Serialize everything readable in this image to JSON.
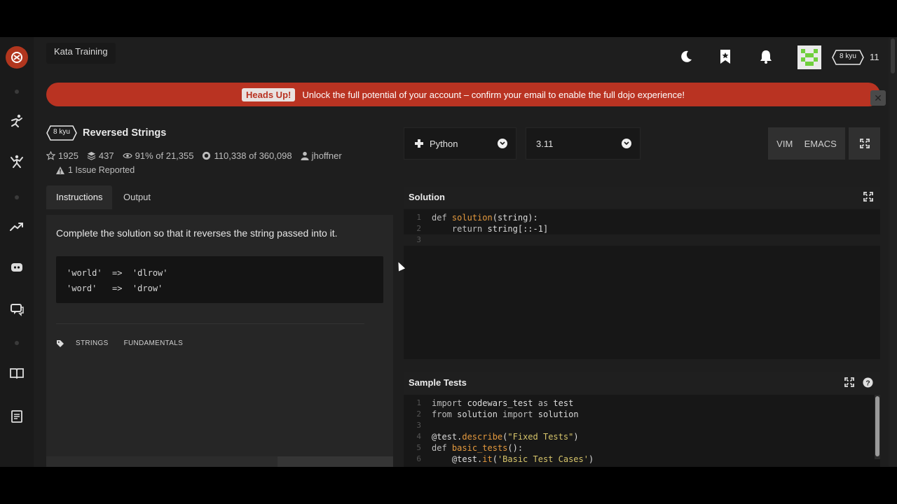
{
  "header": {
    "tab_label": "Kata Training",
    "rank_badge": "8 kyu",
    "honor": "11",
    "icons": [
      "moon-icon",
      "bookmark-icon",
      "bell-icon",
      "avatar"
    ]
  },
  "sidebar": {
    "icons": [
      "logo",
      "dojo-icon",
      "kata-icon",
      "trending-icon",
      "discord-icon",
      "chat-icon",
      "book-icon",
      "docs-icon"
    ]
  },
  "banner": {
    "pill": "Heads Up!",
    "message": "Unlock the full potential of your account – confirm your email to enable the full dojo experience!"
  },
  "kata": {
    "kyu": "8 kyu",
    "title": "Reversed Strings",
    "stars": "1925",
    "collections": "437",
    "satisfaction": "91% of 21,355",
    "completed": "110,338 of 360,098",
    "author": "jhoffner",
    "issues": "1 Issue Reported"
  },
  "tabs": {
    "instructions": "Instructions",
    "output": "Output"
  },
  "instructions": {
    "text": "Complete the solution so that it reverses the string passed into it.",
    "example_lines": [
      "'world'  =>  'dlrow'",
      "'word'   =>  'drow'"
    ],
    "tags": [
      "STRINGS",
      "FUNDAMENTALS"
    ]
  },
  "editor": {
    "language": "Python",
    "version": "3.11",
    "modes": [
      "VIM",
      "EMACS"
    ],
    "solution_title": "Solution",
    "tests_title": "Sample Tests",
    "solution_line_numbers": [
      "1",
      "2",
      "3"
    ],
    "test_line_numbers": [
      "1",
      "2",
      "3",
      "4",
      "5",
      "6"
    ]
  },
  "colors": {
    "banner": "#b93322",
    "accent": "#e59a3e",
    "background": "#1e1e1e"
  }
}
